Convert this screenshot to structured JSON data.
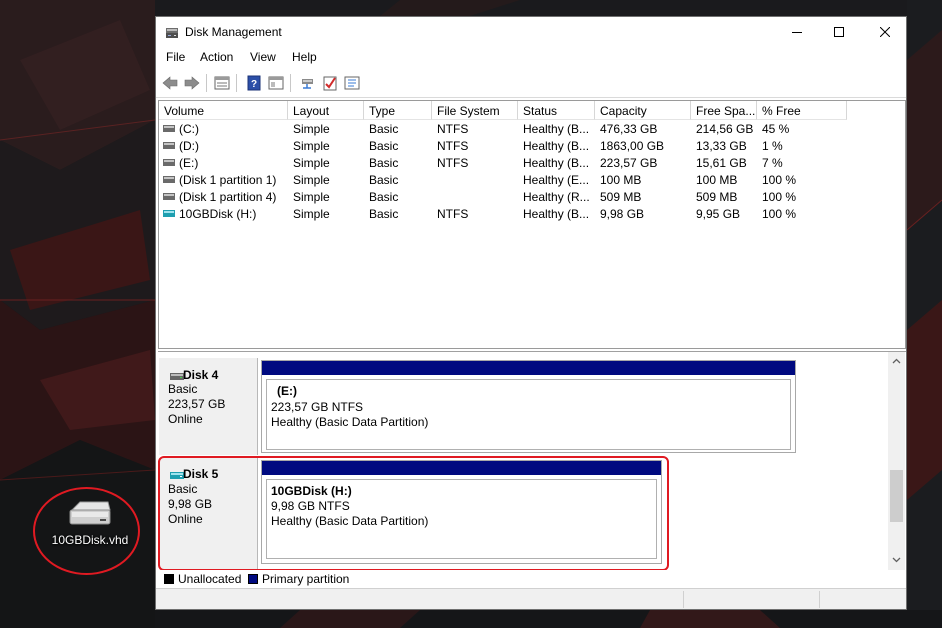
{
  "desktop": {
    "icon_label": "10GBDisk.vhd",
    "annotation_color": "#e01a22"
  },
  "window": {
    "title": "Disk Management",
    "menu": [
      "File",
      "Action",
      "View",
      "Help"
    ],
    "toolbar_icons": [
      "back-icon",
      "forward-icon",
      "properties-icon",
      "help-icon",
      "show-hide-pane-icon",
      "connect-icon",
      "check-icon",
      "settings-icon"
    ]
  },
  "volume_list": {
    "columns": [
      "Volume",
      "Layout",
      "Type",
      "File System",
      "Status",
      "Capacity",
      "Free Spa...",
      "% Free"
    ],
    "rows": [
      {
        "volume": "(C:)",
        "layout": "Simple",
        "type": "Basic",
        "fs": "NTFS",
        "status": "Healthy (B...",
        "capacity": "476,33 GB",
        "free": "214,56 GB",
        "pct": "45 %",
        "icon": "drive-icon"
      },
      {
        "volume": "(D:)",
        "layout": "Simple",
        "type": "Basic",
        "fs": "NTFS",
        "status": "Healthy (B...",
        "capacity": "1863,00 GB",
        "free": "13,33 GB",
        "pct": "1 %",
        "icon": "drive-icon"
      },
      {
        "volume": "(E:)",
        "layout": "Simple",
        "type": "Basic",
        "fs": "NTFS",
        "status": "Healthy (B...",
        "capacity": "223,57 GB",
        "free": "15,61 GB",
        "pct": "7 %",
        "icon": "drive-icon"
      },
      {
        "volume": "(Disk 1 partition 1)",
        "layout": "Simple",
        "type": "Basic",
        "fs": "",
        "status": "Healthy (E...",
        "capacity": "100 MB",
        "free": "100 MB",
        "pct": "100 %",
        "icon": "drive-icon"
      },
      {
        "volume": "(Disk 1 partition 4)",
        "layout": "Simple",
        "type": "Basic",
        "fs": "",
        "status": "Healthy (R...",
        "capacity": "509 MB",
        "free": "509 MB",
        "pct": "100 %",
        "icon": "drive-icon"
      },
      {
        "volume": "10GBDisk (H:)",
        "layout": "Simple",
        "type": "Basic",
        "fs": "NTFS",
        "status": "Healthy (B...",
        "capacity": "9,98 GB",
        "free": "9,95 GB",
        "pct": "100 %",
        "icon": "virtual-drive-icon"
      }
    ]
  },
  "disks": [
    {
      "name": "Disk 4",
      "type": "Basic",
      "size": "223,57 GB",
      "state": "Online",
      "partition": {
        "name": "(E:)",
        "size_fs": "223,57 GB NTFS",
        "status": "Healthy (Basic Data Partition)"
      }
    },
    {
      "name": "Disk 5",
      "type": "Basic",
      "size": "9,98 GB",
      "state": "Online",
      "partition": {
        "name": "10GBDisk  (H:)",
        "size_fs": "9,98 GB NTFS",
        "status": "Healthy (Basic Data Partition)"
      }
    }
  ],
  "legend": [
    {
      "label": "Unallocated",
      "color": "#000000"
    },
    {
      "label": "Primary partition",
      "color": "#000a80"
    }
  ]
}
